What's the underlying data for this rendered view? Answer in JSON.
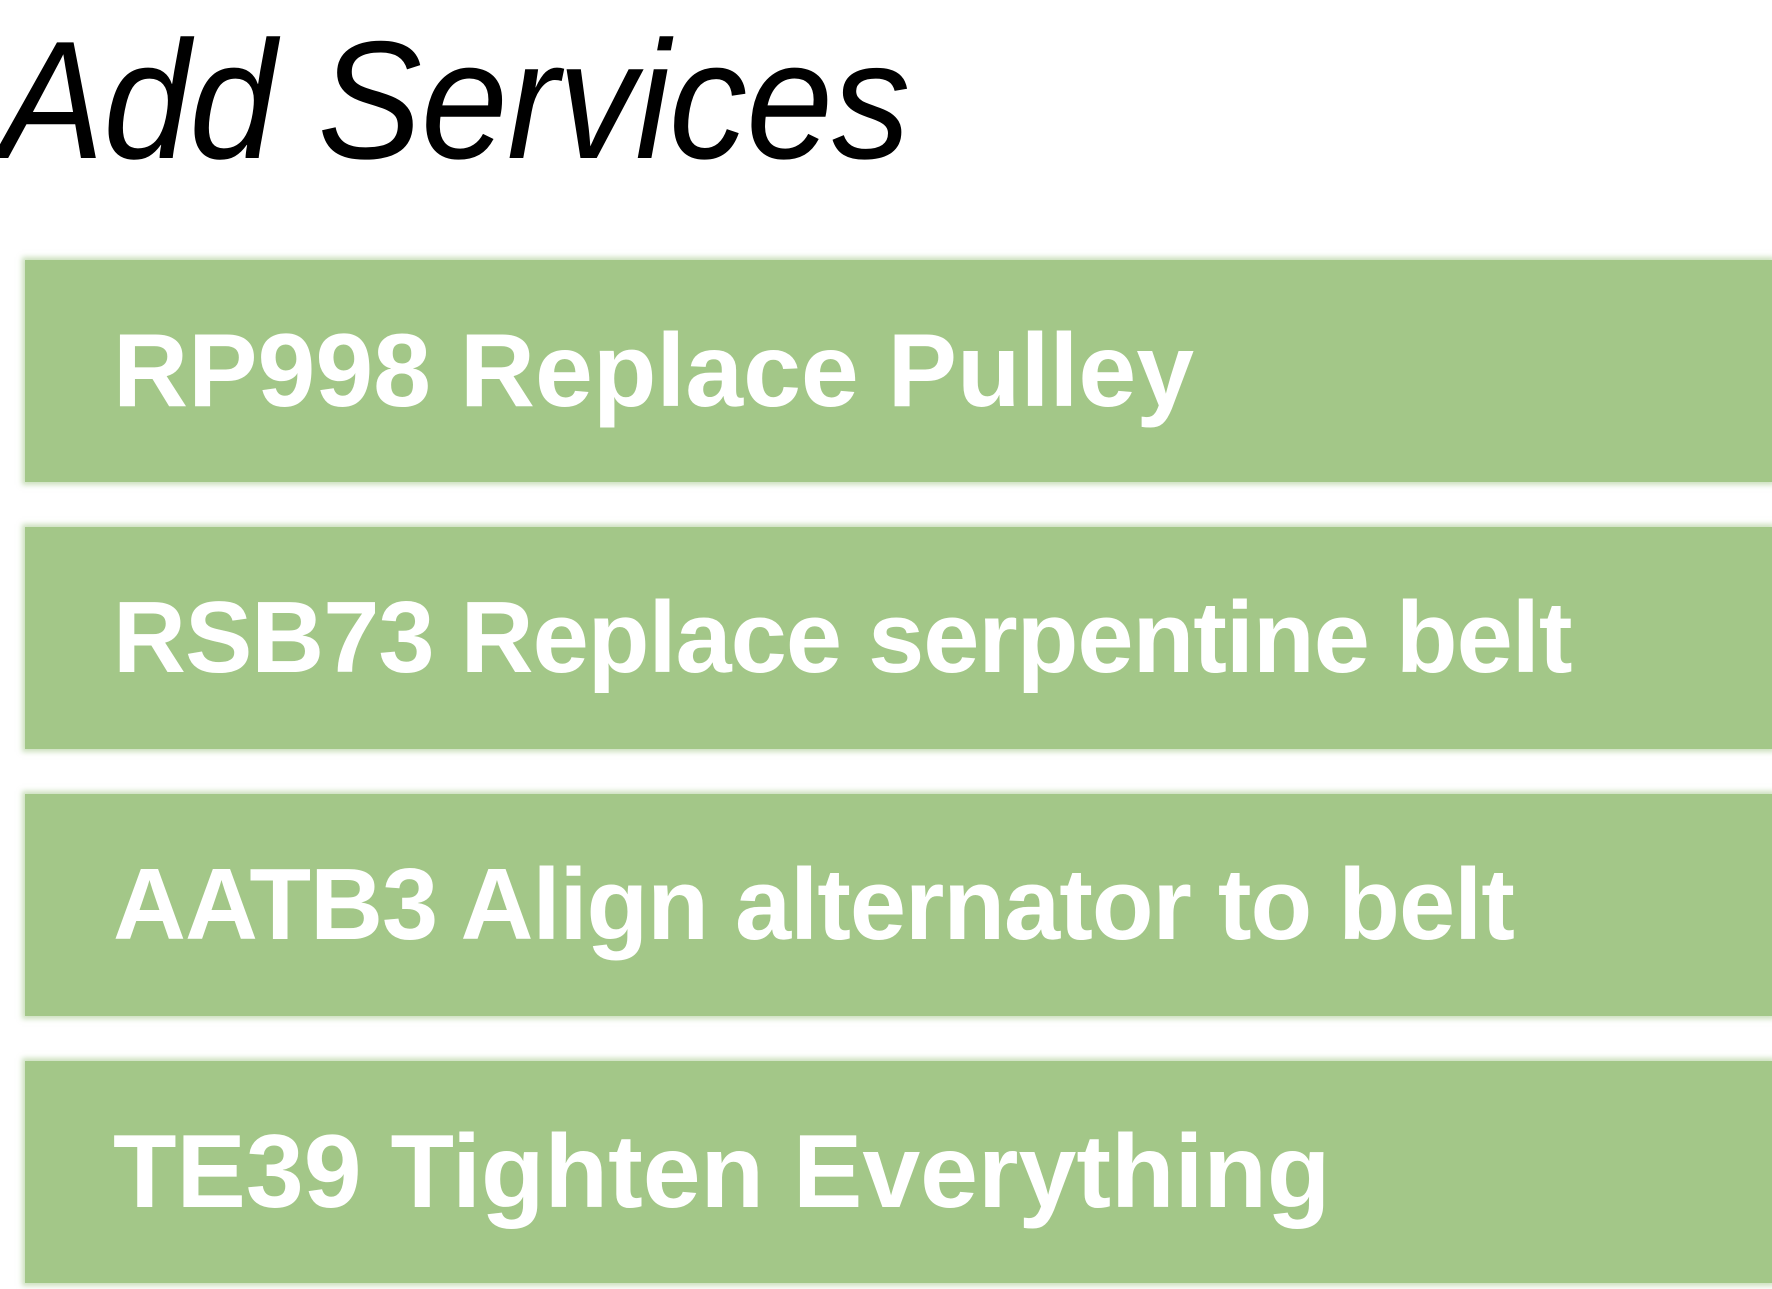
{
  "page": {
    "title": "Add Services"
  },
  "services": {
    "items": [
      {
        "label": "RP998 Replace Pulley"
      },
      {
        "label": "RSB73 Replace serpentine belt"
      },
      {
        "label": "AATB3 Align alternator to belt"
      },
      {
        "label": "TE39 Tighten Everything"
      }
    ]
  },
  "colors": {
    "item_background": "#a3c788",
    "item_text": "#ffffff",
    "title_text": "#000000",
    "page_background": "#ffffff"
  }
}
